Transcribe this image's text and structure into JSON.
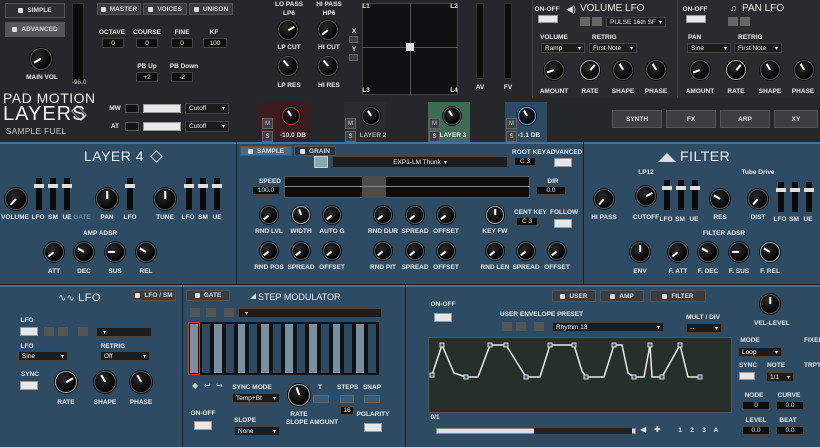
{
  "top_left": {
    "simple": "SIMPLE",
    "advanced": "ADVANCED",
    "main_vol": "MAIN VOL",
    "vol_db": "-96.0"
  },
  "brand": {
    "line1": "PAD MOTION",
    "line2": "LAYERS",
    "line3": "SAMPLE FUEL"
  },
  "master_tabs": [
    "MASTER",
    "VOICES",
    "UNISON"
  ],
  "tune": {
    "octave": {
      "label": "OCTAVE",
      "value": "0"
    },
    "course": {
      "label": "COURSE",
      "value": "0"
    },
    "fine": {
      "label": "FINE",
      "value": "0"
    },
    "kf": {
      "label": "KF",
      "value": "100"
    },
    "pb_up": {
      "label": "PB Up",
      "value": "+2"
    },
    "pb_down": {
      "label": "PB Down",
      "value": "-2"
    }
  },
  "mod_src": {
    "mw": "MW",
    "at": "AT",
    "mw_target": "Cutoff",
    "at_target": "Cutoff"
  },
  "master_filter": {
    "lp_pass": "LO PASS",
    "lp6": "LP6",
    "lp_cut": "LP CUT",
    "lp_res": "LP RES",
    "hi_pass": "HI PASS",
    "hp6": "HP6",
    "hi_cut": "HI CUT",
    "hi_res": "HI RES"
  },
  "layers": [
    {
      "label": "",
      "db": "-10.0 dB"
    },
    {
      "label": "LAYER 2",
      "db": ""
    },
    {
      "label": "LAYER 3",
      "db": ""
    },
    {
      "label": "",
      "db": "-1.1 dB"
    }
  ],
  "xy": {
    "l1": "L1",
    "l2": "L2",
    "l3": "L3",
    "l4": "L4",
    "x": "X",
    "y": "Y",
    "av": "AV",
    "fv": "FV"
  },
  "vol_lfo": {
    "on_off": "ON-OFF",
    "title": "VOLUME LFO",
    "preset": "PULSE 16th SF",
    "volume": "VOLUME",
    "retrig": "RETRIG",
    "shape_val": "Ramp",
    "retrig_val": "First Note",
    "amount": "AMOUNT",
    "rate": "RATE",
    "shape": "SHAPE",
    "phase": "PHASE"
  },
  "pan_lfo": {
    "on_off": "ON-OFF",
    "title": "PAN LFO",
    "pan": "PAN",
    "retrig": "RETRIG",
    "shape_val": "Sine",
    "retrig_val": "First Note",
    "amount": "AMOUNT",
    "rate": "RATE",
    "shape": "SHAPE",
    "phase": "PHASE"
  },
  "fx_tabs": [
    "SYNTH",
    "FX",
    "ARP",
    "XY"
  ],
  "layer4": {
    "title": "LAYER 4",
    "volume": "VOLUME",
    "lfo": "LFO",
    "sm": "SM",
    "ue": "UE",
    "gate": "GATE",
    "pan": "PAN",
    "tune": "TUNE",
    "amp_adsr": "AMP ADSR",
    "att": "ATT",
    "dec": "DEC",
    "sus": "SUS",
    "rel": "REL"
  },
  "sample": {
    "sample_tab": "SAMPLE",
    "grain_tab": "GRAIN",
    "name": "EXP1-LM Thunk",
    "root_key": "ROOT KEY",
    "root_val": "C 3",
    "advanced": "ADVANCED",
    "speed": "SPEED",
    "speed_val": "100.0",
    "dir": "DIR",
    "dir_val": "0.0",
    "rnd_lvl": "RND LVL",
    "width": "WIDTH",
    "auto_g": "AUTO G",
    "rnd_dur": "RND DUR",
    "spread": "SPREAD",
    "offset": "OFFSET",
    "key_fw": "KEY FW",
    "cent_key": "CENT KEY",
    "cent_val": "C 3",
    "follow": "FOLLOW",
    "rnd_pos": "RND POS",
    "rnd_pit": "RND PIT",
    "rnd_len": "RND LEN"
  },
  "filter": {
    "title": "FILTER",
    "lp12": "LP12",
    "tube": "Tube Drive",
    "hi_pass": "HI PASS",
    "cutoff": "CUTOFF",
    "lfo": "LFO",
    "sm": "SM",
    "ue": "UE",
    "res": "RES",
    "dist": "DIST",
    "adsr": "FILTER ADSR",
    "env": "ENV",
    "f_att": "F. ATT",
    "f_dec": "F. DEC",
    "f_sus": "F. SUS",
    "f_rel": "F. REL"
  },
  "lfo": {
    "title": "LFO",
    "lfo_sm": "LFO / SM",
    "lfo_lbl": "LFO",
    "shape_lbl": "LFO",
    "shape_val": "Sine",
    "retrig": "RETRIG",
    "retrig_val": "Off",
    "sync": "SYNC",
    "rate": "RATE",
    "shape": "SHAPE",
    "phase": "PHASE"
  },
  "step": {
    "gate": "GATE",
    "title": "STEP MODULATOR",
    "sync_mode": "SYNC MODE",
    "sync_val": "Temp+Bt",
    "t": "T",
    "steps": "STEPS",
    "steps_val": "16",
    "snap": "SNAP",
    "on_off": "ON-OFF",
    "slope": "SLOPE",
    "slope_val": "None",
    "rate": "RATE",
    "slope_amt": "SLOPE AMOUNT",
    "polarity": "POLARITY"
  },
  "env": {
    "on_off": "ON-OFF",
    "user": "USER",
    "amp": "AMP",
    "filter": "FILTER",
    "preset_lbl": "USER ENVELOPE PRESET",
    "preset_val": "Rhythm 13",
    "mult": "MULT / DIV",
    "mult_val": "--",
    "vel": "VEL-LEVEL",
    "mode": "MODE",
    "mode_val": "Loop",
    "fixed": "FIXED",
    "sync": "SYNC",
    "note": "NOTE",
    "note_val": "1/1",
    "trpt": "TRPT",
    "node": "NODE",
    "node_val": "0",
    "curve": "CURVE",
    "curve_val": "0.0",
    "level": "LEVEL",
    "level_val": "0.0",
    "beat": "BEAT",
    "beat_val": "0.0",
    "ratio": "0/1",
    "pages": [
      "1",
      "2",
      "3",
      "A"
    ]
  },
  "colors": {
    "panel_blue": "#2d4b62",
    "dark": "#222326",
    "layer3_green": "#3f6b55"
  }
}
